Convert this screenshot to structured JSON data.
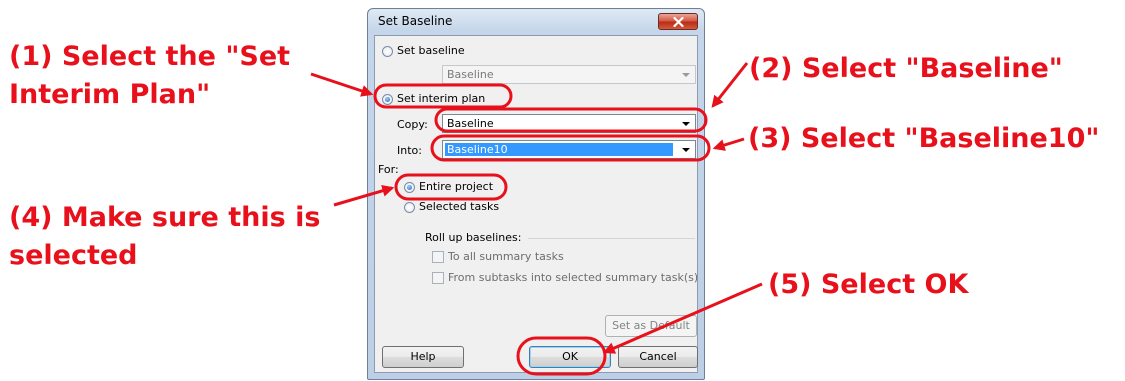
{
  "annotations": {
    "step1": [
      "(1) Select the \"Set",
      "Interim Plan\""
    ],
    "step2": "(2) Select \"Baseline\"",
    "step3": "(3) Select \"Baseline10\"",
    "step4": [
      "(4) Make sure this is",
      "selected"
    ],
    "step5": "(5) Select OK"
  },
  "colors": {
    "annotation_red": "#e8101b",
    "selection_blue": "#3399ff"
  },
  "dialog": {
    "title": "Set Baseline",
    "close_icon": "close-x",
    "set_baseline_label": "Set baseline",
    "set_baseline_value": "Baseline",
    "set_interim_plan_label": "Set interim plan",
    "copy_label": "Copy:",
    "copy_value": "Baseline",
    "into_label": "Into:",
    "into_value": "Baseline10",
    "for_label": "For:",
    "entire_project_label": "Entire project",
    "selected_tasks_label": "Selected tasks",
    "rollup_label": "Roll up baselines:",
    "to_all_summary_label": "To all summary tasks",
    "from_subtasks_label": "From subtasks into selected summary task(s)",
    "set_as_default_label": "Set as Default",
    "help_label": "Help",
    "ok_label": "OK",
    "cancel_label": "Cancel",
    "selected_option": "Set interim plan",
    "selected_scope": "Entire project"
  }
}
